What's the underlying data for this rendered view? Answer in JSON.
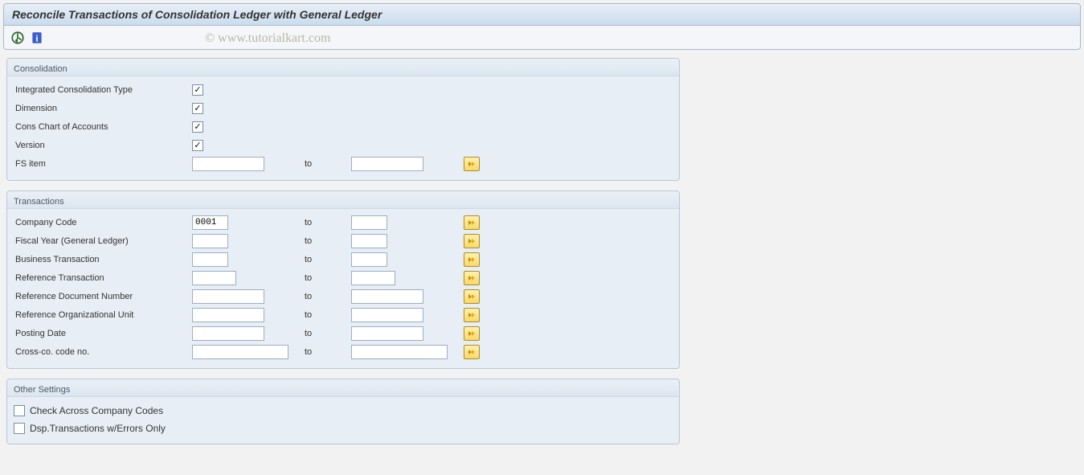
{
  "title": "Reconcile Transactions of Consolidation Ledger with General Ledger",
  "watermark": "© www.tutorialkart.com",
  "to_label": "to",
  "groups": {
    "consolidation": {
      "title": "Consolidation",
      "rows": {
        "ict": {
          "label": "Integrated Consolidation Type",
          "checked": true
        },
        "dim": {
          "label": "Dimension",
          "checked": true
        },
        "coa": {
          "label": "Cons Chart of Accounts",
          "checked": true
        },
        "ver": {
          "label": "Version",
          "checked": true
        },
        "fsitem": {
          "label": "FS item",
          "from": "",
          "to": ""
        }
      }
    },
    "transactions": {
      "title": "Transactions",
      "rows": {
        "ccode": {
          "label": "Company Code",
          "from": "0001",
          "to": "",
          "w_from": 45,
          "w_to": 45
        },
        "fyear": {
          "label": "Fiscal Year (General Ledger)",
          "from": "",
          "to": "",
          "w_from": 45,
          "w_to": 45
        },
        "btrans": {
          "label": "Business Transaction",
          "from": "",
          "to": "",
          "w_from": 45,
          "w_to": 45
        },
        "rtrans": {
          "label": "Reference Transaction",
          "from": "",
          "to": "",
          "w_from": 55,
          "w_to": 55
        },
        "rdoc": {
          "label": "Reference Document Number",
          "from": "",
          "to": "",
          "w_from": 90,
          "w_to": 90
        },
        "rorg": {
          "label": "Reference Organizational Unit",
          "from": "",
          "to": "",
          "w_from": 90,
          "w_to": 90
        },
        "pdate": {
          "label": "Posting Date",
          "from": "",
          "to": "",
          "w_from": 90,
          "w_to": 90
        },
        "ccno": {
          "label": "Cross-co. code no.",
          "from": "",
          "to": "",
          "w_from": 120,
          "w_to": 120
        }
      }
    },
    "other": {
      "title": "Other Settings",
      "items": {
        "cacc": {
          "label": "Check Across Company Codes",
          "checked": false
        },
        "derr": {
          "label": "Dsp.Transactions w/Errors Only",
          "checked": false
        }
      }
    }
  }
}
